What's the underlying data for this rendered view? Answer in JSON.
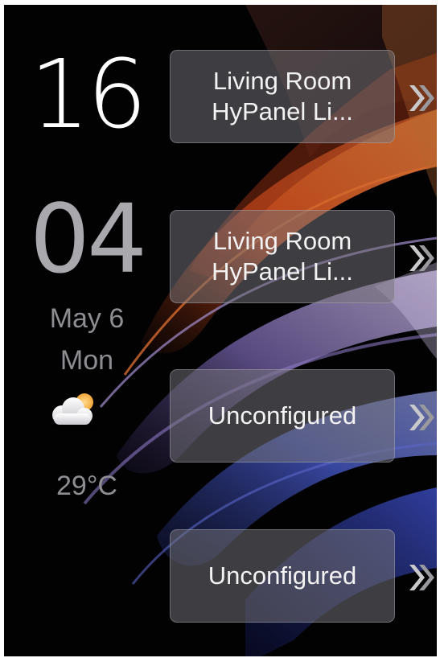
{
  "clock": {
    "hour": "16",
    "minute": "04"
  },
  "date": {
    "month_day": "May 6",
    "weekday": "Mon"
  },
  "weather": {
    "icon": "partly-cloudy-icon",
    "temperature": "29°C"
  },
  "tiles": [
    {
      "label_line1": "Living Room",
      "label_line2": "HyPanel Li..."
    },
    {
      "label_line1": "Living Room",
      "label_line2": "HyPanel Li..."
    },
    {
      "label": "Unconfigured"
    },
    {
      "label": "Unconfigured"
    }
  ],
  "icons": {
    "tile_arrow": "double-chevron-right-icon"
  },
  "colors": {
    "background": "#020203",
    "clock_hour": "#ffffff",
    "clock_minute": "#a9a9ad",
    "secondary_text": "#8d8d92",
    "tile_fill": "rgba(118,116,122,0.52)",
    "wave_orange": "#d4521e",
    "wave_purple": "#6b55a8",
    "wave_blue": "#3e4fb0"
  }
}
